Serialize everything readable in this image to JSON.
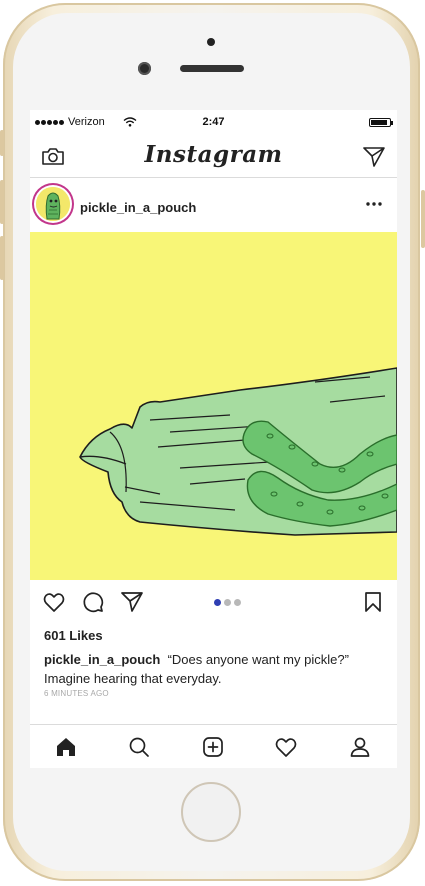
{
  "status_bar": {
    "carrier": "Verizon",
    "time": "2:47",
    "battery_level": 0.9
  },
  "header": {
    "app_title": "Instagram",
    "left_icon": "camera-icon",
    "right_icon": "direct-message-icon"
  },
  "post": {
    "username": "pickle_in_a_pouch",
    "more_icon": "more-options-icon",
    "carousel": {
      "count": 3,
      "active_index": 0
    },
    "likes": "601 Likes",
    "caption_user": "pickle_in_a_pouch",
    "caption_text": "“Does anyone want my pickle?” Imagine hearing that everyday.",
    "time_ago": "6 MINUTES AGO",
    "colors": {
      "image_bg": "#f8f677",
      "pouch": "#a6dca0",
      "pickle": "#6cc46f",
      "active_dot": "#2f3fb3"
    }
  },
  "actions": {
    "like_icon": "heart-icon",
    "comment_icon": "comment-icon",
    "share_icon": "share-icon",
    "save_icon": "bookmark-icon"
  },
  "tab_bar": {
    "items": [
      "home-icon",
      "search-icon",
      "new-post-icon",
      "activity-icon",
      "profile-icon"
    ],
    "active": "home-icon"
  }
}
